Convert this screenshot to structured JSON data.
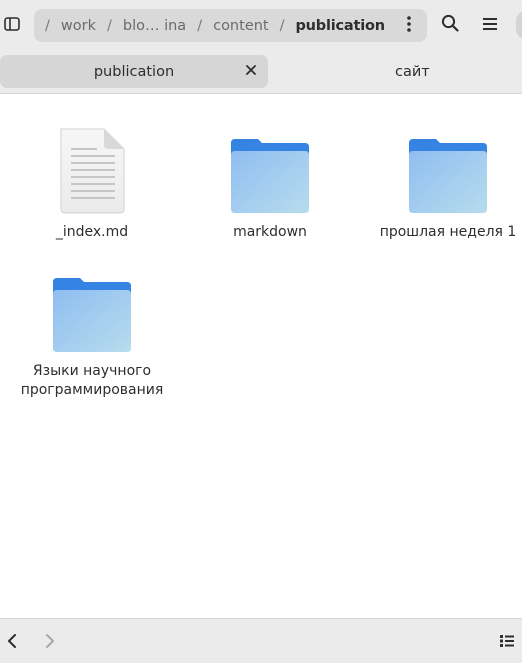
{
  "headerbar": {
    "sidebar_toggle_icon": "sidebar-show-icon",
    "path": [
      {
        "label": "work"
      },
      {
        "label": "blo… ina"
      },
      {
        "label": "content"
      },
      {
        "label": "publication"
      }
    ],
    "path_separator": "/",
    "path_menu_icon": "vertical-dots-icon",
    "search_icon": "search-icon",
    "main_menu_icon": "hamburger-menu-icon"
  },
  "tabs": [
    {
      "label": "publication",
      "active": true
    },
    {
      "label": "сайт",
      "active": false
    }
  ],
  "items": [
    {
      "label": "_index.md",
      "type": "text-file"
    },
    {
      "label": "markdown",
      "type": "folder"
    },
    {
      "label": "прошлая неделя 1",
      "type": "folder"
    },
    {
      "label": "Языки научного программирования",
      "type": "folder"
    }
  ],
  "bottombar": {
    "back_icon": "chevron-left-icon",
    "forward_icon": "chevron-right-icon",
    "view_icon": "list-view-icon"
  },
  "colors": {
    "folder_tab": "#3584e4",
    "folder_body_top": "#8fbdf0",
    "folder_body_bottom": "#b7dcee",
    "chrome_bg": "#ebebeb"
  }
}
